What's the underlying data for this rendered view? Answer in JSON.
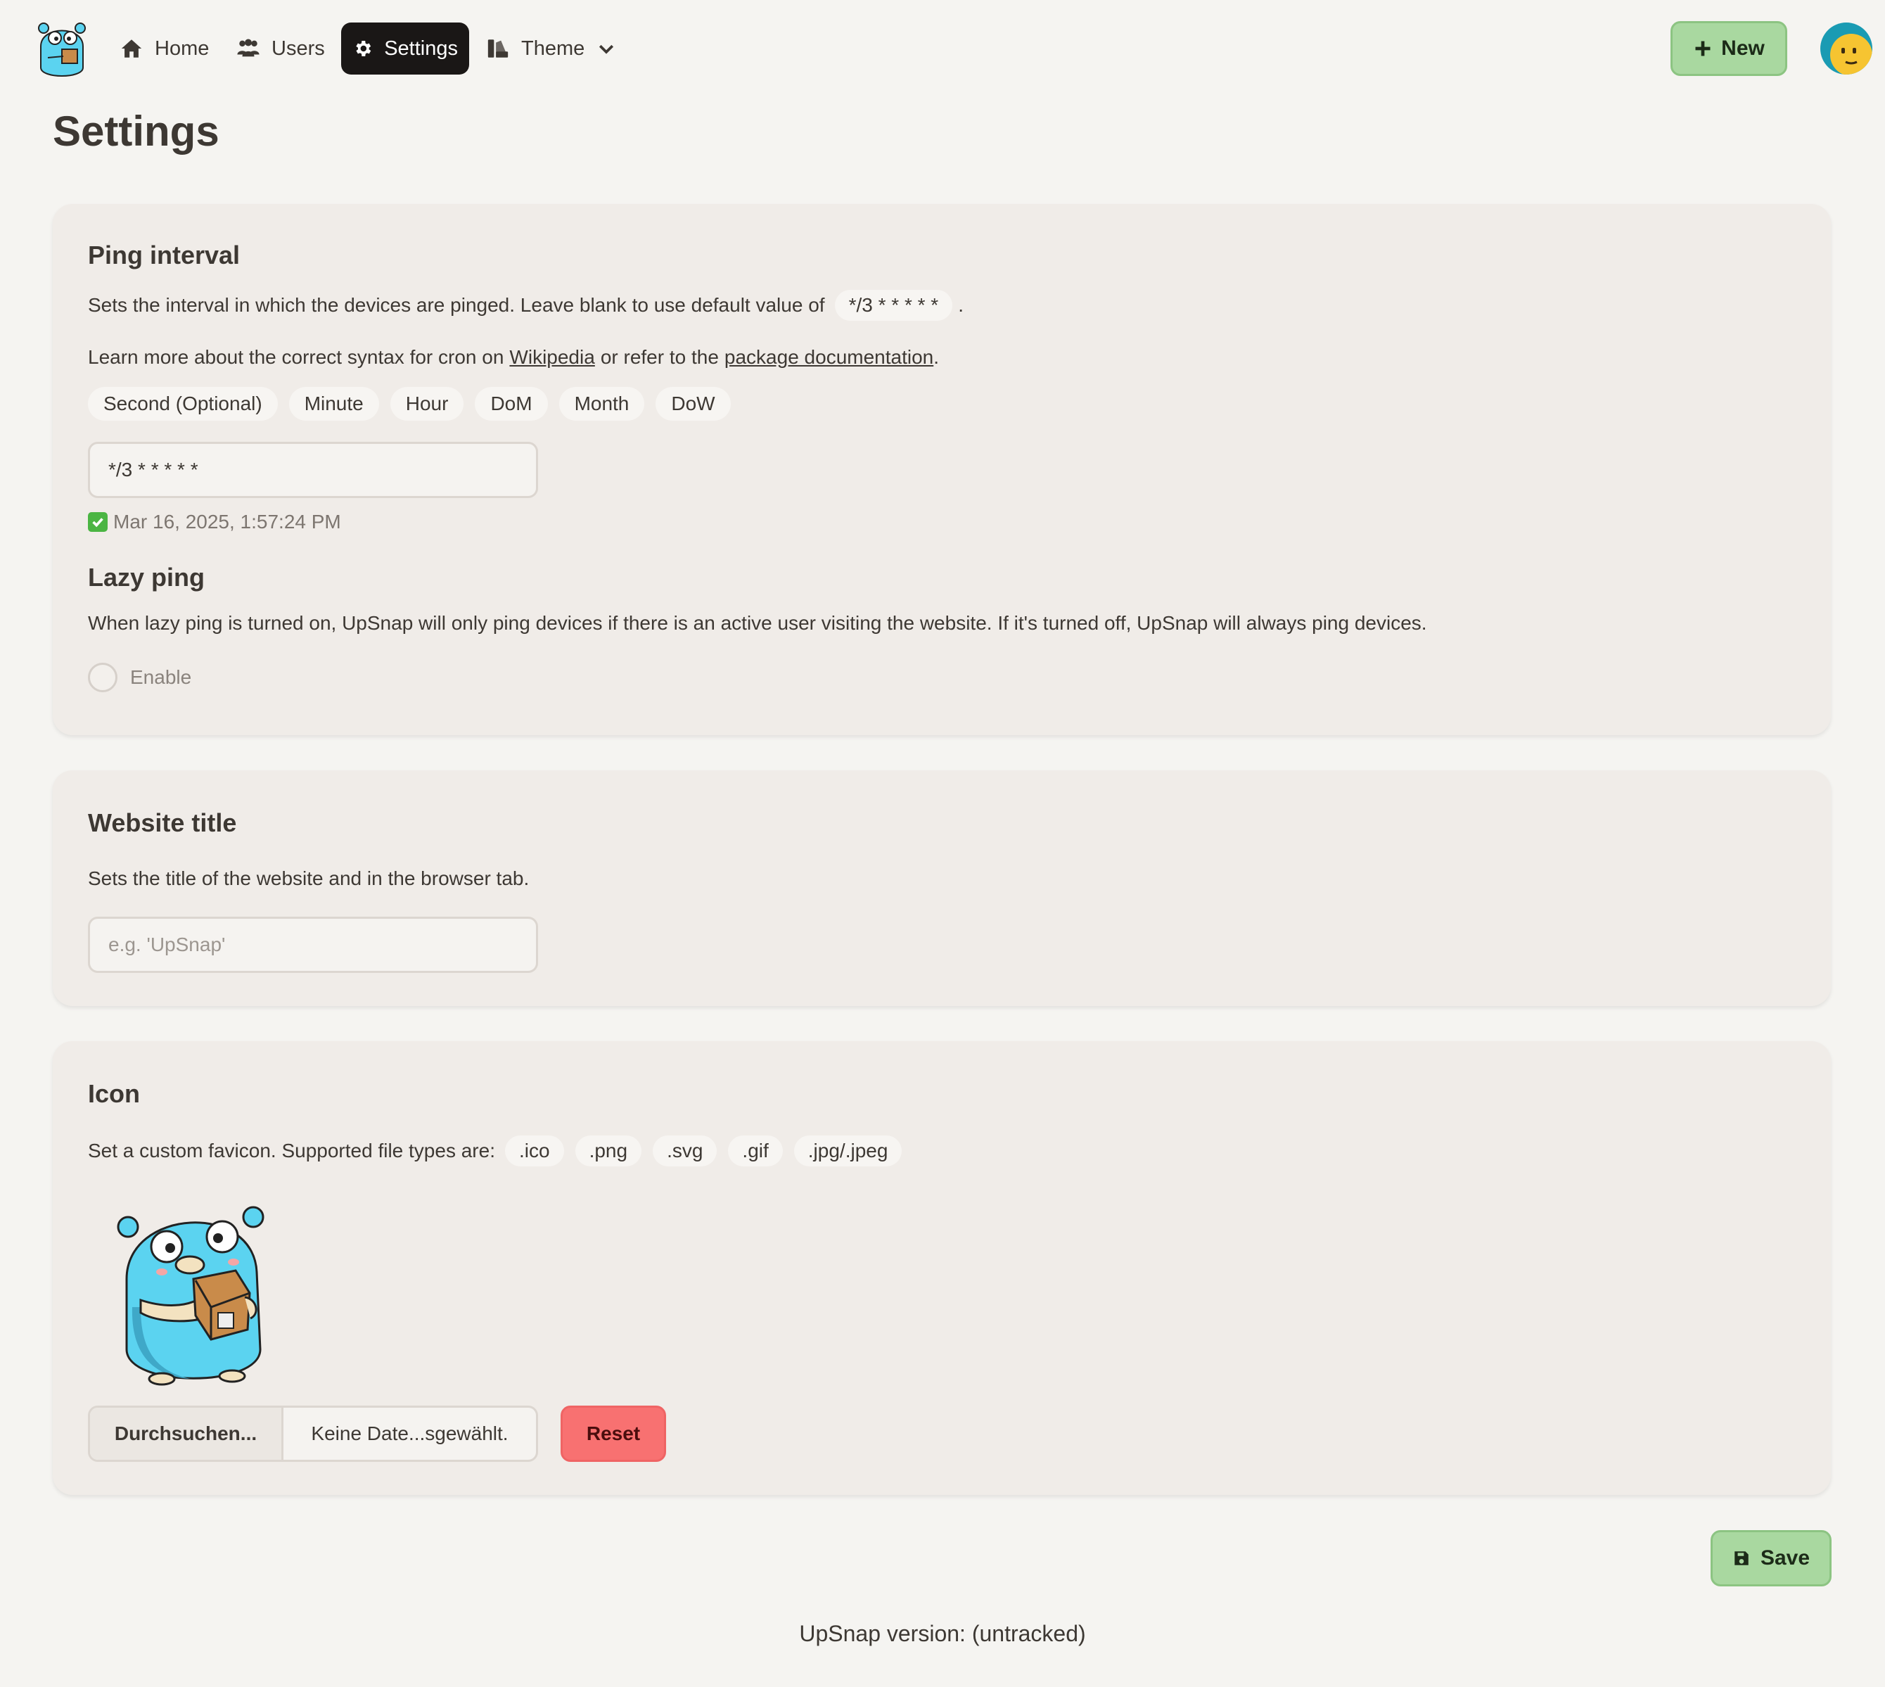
{
  "nav": {
    "home": "Home",
    "users": "Users",
    "settings": "Settings",
    "theme": "Theme",
    "new_button": "New"
  },
  "page": {
    "title": "Settings"
  },
  "ping": {
    "title": "Ping interval",
    "desc_prefix": "Sets the interval in which the devices are pinged. Leave blank to use default value of",
    "default_value": "*/3 * * * * *",
    "desc_suffix": ".",
    "learn_prefix": "Learn more about the correct syntax for cron on",
    "wikipedia_link": "Wikipedia",
    "learn_mid": "or refer to the",
    "docs_link": "package documentation",
    "learn_suffix": ".",
    "fields": [
      "Second (Optional)",
      "Minute",
      "Hour",
      "DoM",
      "Month",
      "DoW"
    ],
    "input_value": "*/3 * * * * *",
    "next_run": "Mar 16, 2025, 1:57:24 PM"
  },
  "lazy": {
    "title": "Lazy ping",
    "desc": "When lazy ping is turned on, UpSnap will only ping devices if there is an active user visiting the website. If it's turned off, UpSnap will always ping devices.",
    "toggle_label": "Enable",
    "enabled": false
  },
  "website_title": {
    "title": "Website title",
    "desc": "Sets the title of the website and in the browser tab.",
    "placeholder": "e.g. 'UpSnap'",
    "value": ""
  },
  "icon": {
    "title": "Icon",
    "desc": "Set a custom favicon. Supported file types are:",
    "types": [
      ".ico",
      ".png",
      ".svg",
      ".gif",
      ".jpg/.jpeg"
    ],
    "browse_button": "Durchsuchen...",
    "file_status": "Keine Date...sgewählt.",
    "reset_button": "Reset"
  },
  "save_button": "Save",
  "footer": "UpSnap version: (untracked)",
  "colors": {
    "background": "#f5f4f1",
    "card": "#f0ece8",
    "accent_green": "#a9d8a0",
    "danger": "#f87171",
    "active_nav": "#1a1716"
  }
}
